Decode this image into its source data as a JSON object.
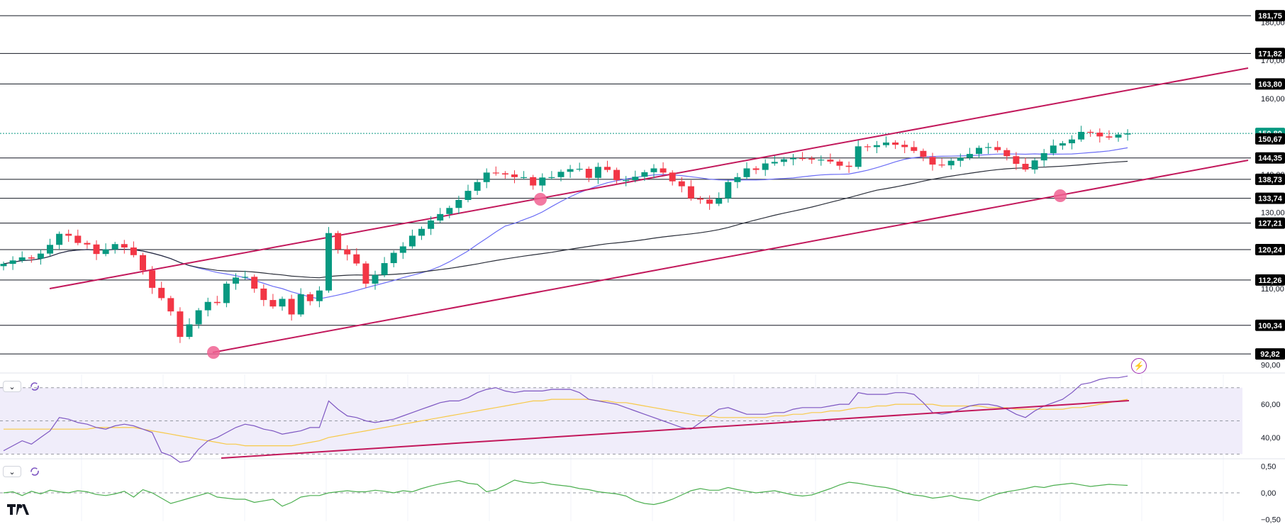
{
  "chart_data": {
    "type": "candlestick",
    "price_axis": {
      "ticks": [
        "180,00",
        "170,00",
        "160,00",
        "150,00",
        "140,00",
        "130,00",
        "120,00",
        "110,00",
        "100,00",
        "90,00"
      ],
      "range": [
        88,
        184
      ]
    },
    "horizontal_levels": [
      {
        "label": "181,75",
        "value": 181.75
      },
      {
        "label": "171,82",
        "value": 171.82
      },
      {
        "label": "163,80",
        "value": 163.8
      },
      {
        "label": "144,35",
        "value": 144.35
      },
      {
        "label": "138,73",
        "value": 138.73
      },
      {
        "label": "133,74",
        "value": 133.74
      },
      {
        "label": "127,21",
        "value": 127.21
      },
      {
        "label": "120,24",
        "value": 120.24
      },
      {
        "label": "112,26",
        "value": 112.26
      },
      {
        "label": "100,34",
        "value": 100.34
      },
      {
        "label": "92,82",
        "value": 92.82
      }
    ],
    "current_price": {
      "label": "150,80",
      "value": 150.8,
      "color": "#089981"
    },
    "secondary_price": {
      "label": "150,67",
      "value": 150.67
    },
    "closes": [
      116.5,
      117.4,
      118.2,
      117.9,
      119.2,
      121.5,
      124.4,
      123.9,
      122.0,
      121.6,
      119.1,
      120.3,
      121.7,
      120.8,
      118.8,
      114.8,
      110.2,
      107.5,
      104.0,
      97.3,
      100.6,
      104.3,
      106.5,
      106.2,
      111.3,
      112.9,
      113.1,
      110.0,
      107.0,
      105.3,
      107.3,
      103.2,
      108.5,
      106.7,
      109.5,
      124.6,
      120.3,
      119.0,
      116.6,
      111.3,
      113.6,
      116.7,
      119.4,
      121.1,
      123.9,
      125.7,
      127.9,
      129.6,
      131.2,
      133.3,
      135.7,
      138.0,
      140.5,
      140.3,
      140.0,
      139.3,
      139.3,
      137.1,
      139.2,
      139.3,
      140.7,
      141.4,
      141.5,
      139.1,
      142.0,
      141.2,
      138.5,
      138.5,
      139.4,
      140.6,
      141.6,
      140.5,
      138.2,
      136.9,
      133.7,
      133.4,
      132.3,
      133.7,
      138.0,
      139.3,
      141.6,
      141.2,
      142.9,
      143.3,
      144.0,
      144.3,
      144.2,
      143.9,
      143.9,
      143.4,
      142.3,
      142.0,
      147.4,
      147.2,
      147.7,
      148.4,
      147.8,
      147.2,
      146.2,
      144.6,
      142.6,
      142.4,
      143.6,
      144.4,
      145.4,
      147.0,
      147.2,
      146.4,
      144.8,
      142.8,
      141.3,
      143.7,
      145.6,
      147.6,
      148.2,
      149.2,
      151.2,
      151.0,
      150.0,
      149.7,
      150.5,
      150.8
    ],
    "rsi": {
      "ticks": [
        "60,00",
        "40,00"
      ],
      "range": [
        28,
        78
      ],
      "upper_band": 70,
      "lower_band": 30,
      "mid": 50,
      "values": [
        32,
        35,
        38,
        36,
        40,
        44,
        52,
        51,
        49,
        48,
        46,
        45,
        47,
        48,
        47,
        45,
        43,
        31,
        29,
        25,
        26,
        33,
        38,
        40,
        43,
        46,
        48,
        47,
        45,
        44,
        42,
        43,
        44,
        46,
        46,
        62,
        57,
        53,
        52,
        50,
        49,
        50,
        51,
        53,
        55,
        57,
        59,
        61,
        62,
        62,
        64,
        67,
        69,
        70,
        68,
        67,
        68,
        68,
        68,
        69,
        69,
        69,
        67,
        63,
        62,
        61,
        60,
        58,
        56,
        54,
        52,
        50,
        48,
        46,
        45,
        49,
        53,
        57,
        58,
        56,
        54,
        54,
        54,
        55,
        55,
        57,
        58,
        58,
        58,
        59,
        60,
        60,
        67,
        66,
        66,
        66,
        67,
        67,
        66,
        61,
        55,
        54,
        55,
        57,
        59,
        60,
        60,
        59,
        57,
        54,
        52,
        56,
        59,
        61,
        63,
        67,
        72,
        73,
        75,
        76,
        76,
        77
      ],
      "ma": [
        45,
        45,
        45,
        45,
        45,
        45,
        45,
        45,
        45,
        45,
        46,
        46,
        46,
        46,
        46,
        45,
        44,
        43,
        42,
        41,
        40,
        39,
        38,
        37,
        36,
        36,
        35,
        35,
        35,
        35,
        35,
        35,
        36,
        37,
        38,
        40,
        41,
        42,
        43,
        44,
        45,
        46,
        47,
        48,
        49,
        50,
        51,
        52,
        53,
        54,
        55,
        56,
        57,
        58,
        59,
        60,
        61,
        62,
        62,
        63,
        63,
        63,
        63,
        63,
        62,
        62,
        61,
        61,
        60,
        59,
        58,
        57,
        56,
        55,
        54,
        53,
        53,
        52,
        52,
        52,
        52,
        52,
        52,
        53,
        53,
        54,
        54,
        55,
        55,
        56,
        56,
        57,
        58,
        58,
        59,
        59,
        60,
        60,
        60,
        60,
        60,
        59,
        59,
        59,
        59,
        59,
        58,
        58,
        58,
        57,
        57,
        57,
        57,
        57,
        57,
        58,
        58,
        59,
        60,
        61,
        62,
        63
      ]
    },
    "oscillator": {
      "ticks": [
        "0,50",
        "0,00",
        "−0,50"
      ],
      "range": [
        -0.6,
        0.6
      ],
      "values": [
        0.0,
        0.02,
        -0.05,
        0.03,
        -0.02,
        0.05,
        0.02,
        0.0,
        0.04,
        0.02,
        -0.03,
        -0.05,
        -0.02,
        0.03,
        -0.08,
        0.06,
        0.0,
        -0.1,
        -0.2,
        -0.15,
        -0.1,
        -0.05,
        0.0,
        -0.08,
        -0.1,
        -0.12,
        -0.12,
        -0.18,
        -0.15,
        -0.12,
        -0.25,
        -0.18,
        -0.08,
        -0.05,
        -0.05,
        0.0,
        0.02,
        0.04,
        0.02,
        0.02,
        0.05,
        0.03,
        0.0,
        0.04,
        0.02,
        0.08,
        0.13,
        0.17,
        0.2,
        0.23,
        0.18,
        0.16,
        0.02,
        0.06,
        0.15,
        0.24,
        0.2,
        0.18,
        0.2,
        0.16,
        0.14,
        0.12,
        0.08,
        0.06,
        0.02,
        0.0,
        -0.02,
        -0.06,
        -0.15,
        -0.2,
        -0.22,
        -0.18,
        -0.12,
        -0.04,
        0.04,
        0.08,
        0.05,
        0.05,
        0.1,
        0.06,
        0.03,
        0.0,
        0.02,
        0.04,
        0.0,
        -0.04,
        -0.06,
        -0.04,
        0.02,
        0.08,
        0.15,
        0.2,
        0.18,
        0.15,
        0.12,
        0.1,
        0.06,
        0.0,
        -0.04,
        -0.06,
        -0.1,
        -0.08,
        -0.05,
        -0.1,
        -0.12,
        -0.15,
        -0.08,
        -0.02,
        0.02,
        0.05,
        0.08,
        0.12,
        0.1,
        0.14,
        0.16,
        0.18,
        0.15,
        0.12,
        0.14,
        0.16,
        0.15,
        0.14
      ]
    }
  },
  "colors": {
    "bull": "#089981",
    "bear": "#f23645",
    "trend": "#c2185b",
    "ma_fast": "#6a6cf5",
    "ma_slow": "#2a2e39",
    "rsi_line": "#7e57c2",
    "rsi_ma": "#f7c948",
    "rsi_band_fill": "#f0edfa",
    "osc_line": "#4caf50",
    "axis_text": "#131722",
    "label_bg": "#000000",
    "marker": "#f06292"
  },
  "icons": {
    "collapse": "chevron-down-icon",
    "sync": "sync-icon",
    "alert": "lightning-icon",
    "logo": "tradingview-logo"
  }
}
